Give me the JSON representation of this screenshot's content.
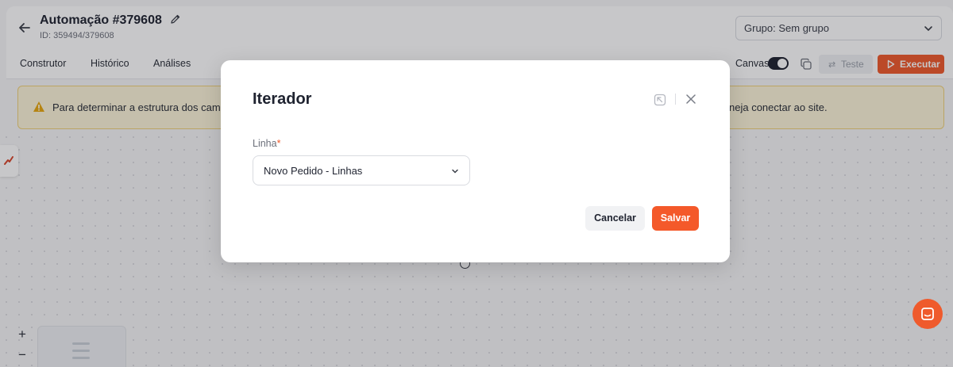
{
  "header": {
    "title": "Automação #379608",
    "subtitle": "ID: 359494/379608",
    "group_select": "Grupo: Sem grupo"
  },
  "tabs": [
    {
      "label": "Construtor"
    },
    {
      "label": "Histórico"
    },
    {
      "label": "Análises"
    }
  ],
  "toolbar": {
    "canvas_label": "Canvas",
    "canvas_toggle_on": true,
    "test_label": "Teste",
    "execute_label": "Executar"
  },
  "alert": {
    "text_start": "Para determinar a estrutura dos camp",
    "text_end": "neja conectar ao site."
  },
  "canvas": {
    "zoom_in": "+",
    "zoom_out": "−"
  },
  "modal": {
    "title": "Iterador",
    "field_label": "Linha",
    "required_mark": "*",
    "select_value": "Novo Pedido - Linhas",
    "cancel_label": "Cancelar",
    "save_label": "Salvar"
  },
  "colors": {
    "accent": "#ef5a2c",
    "alert_bg": "#fdf5d9",
    "alert_border": "#f0d27a",
    "text_dark": "#1f2330"
  }
}
